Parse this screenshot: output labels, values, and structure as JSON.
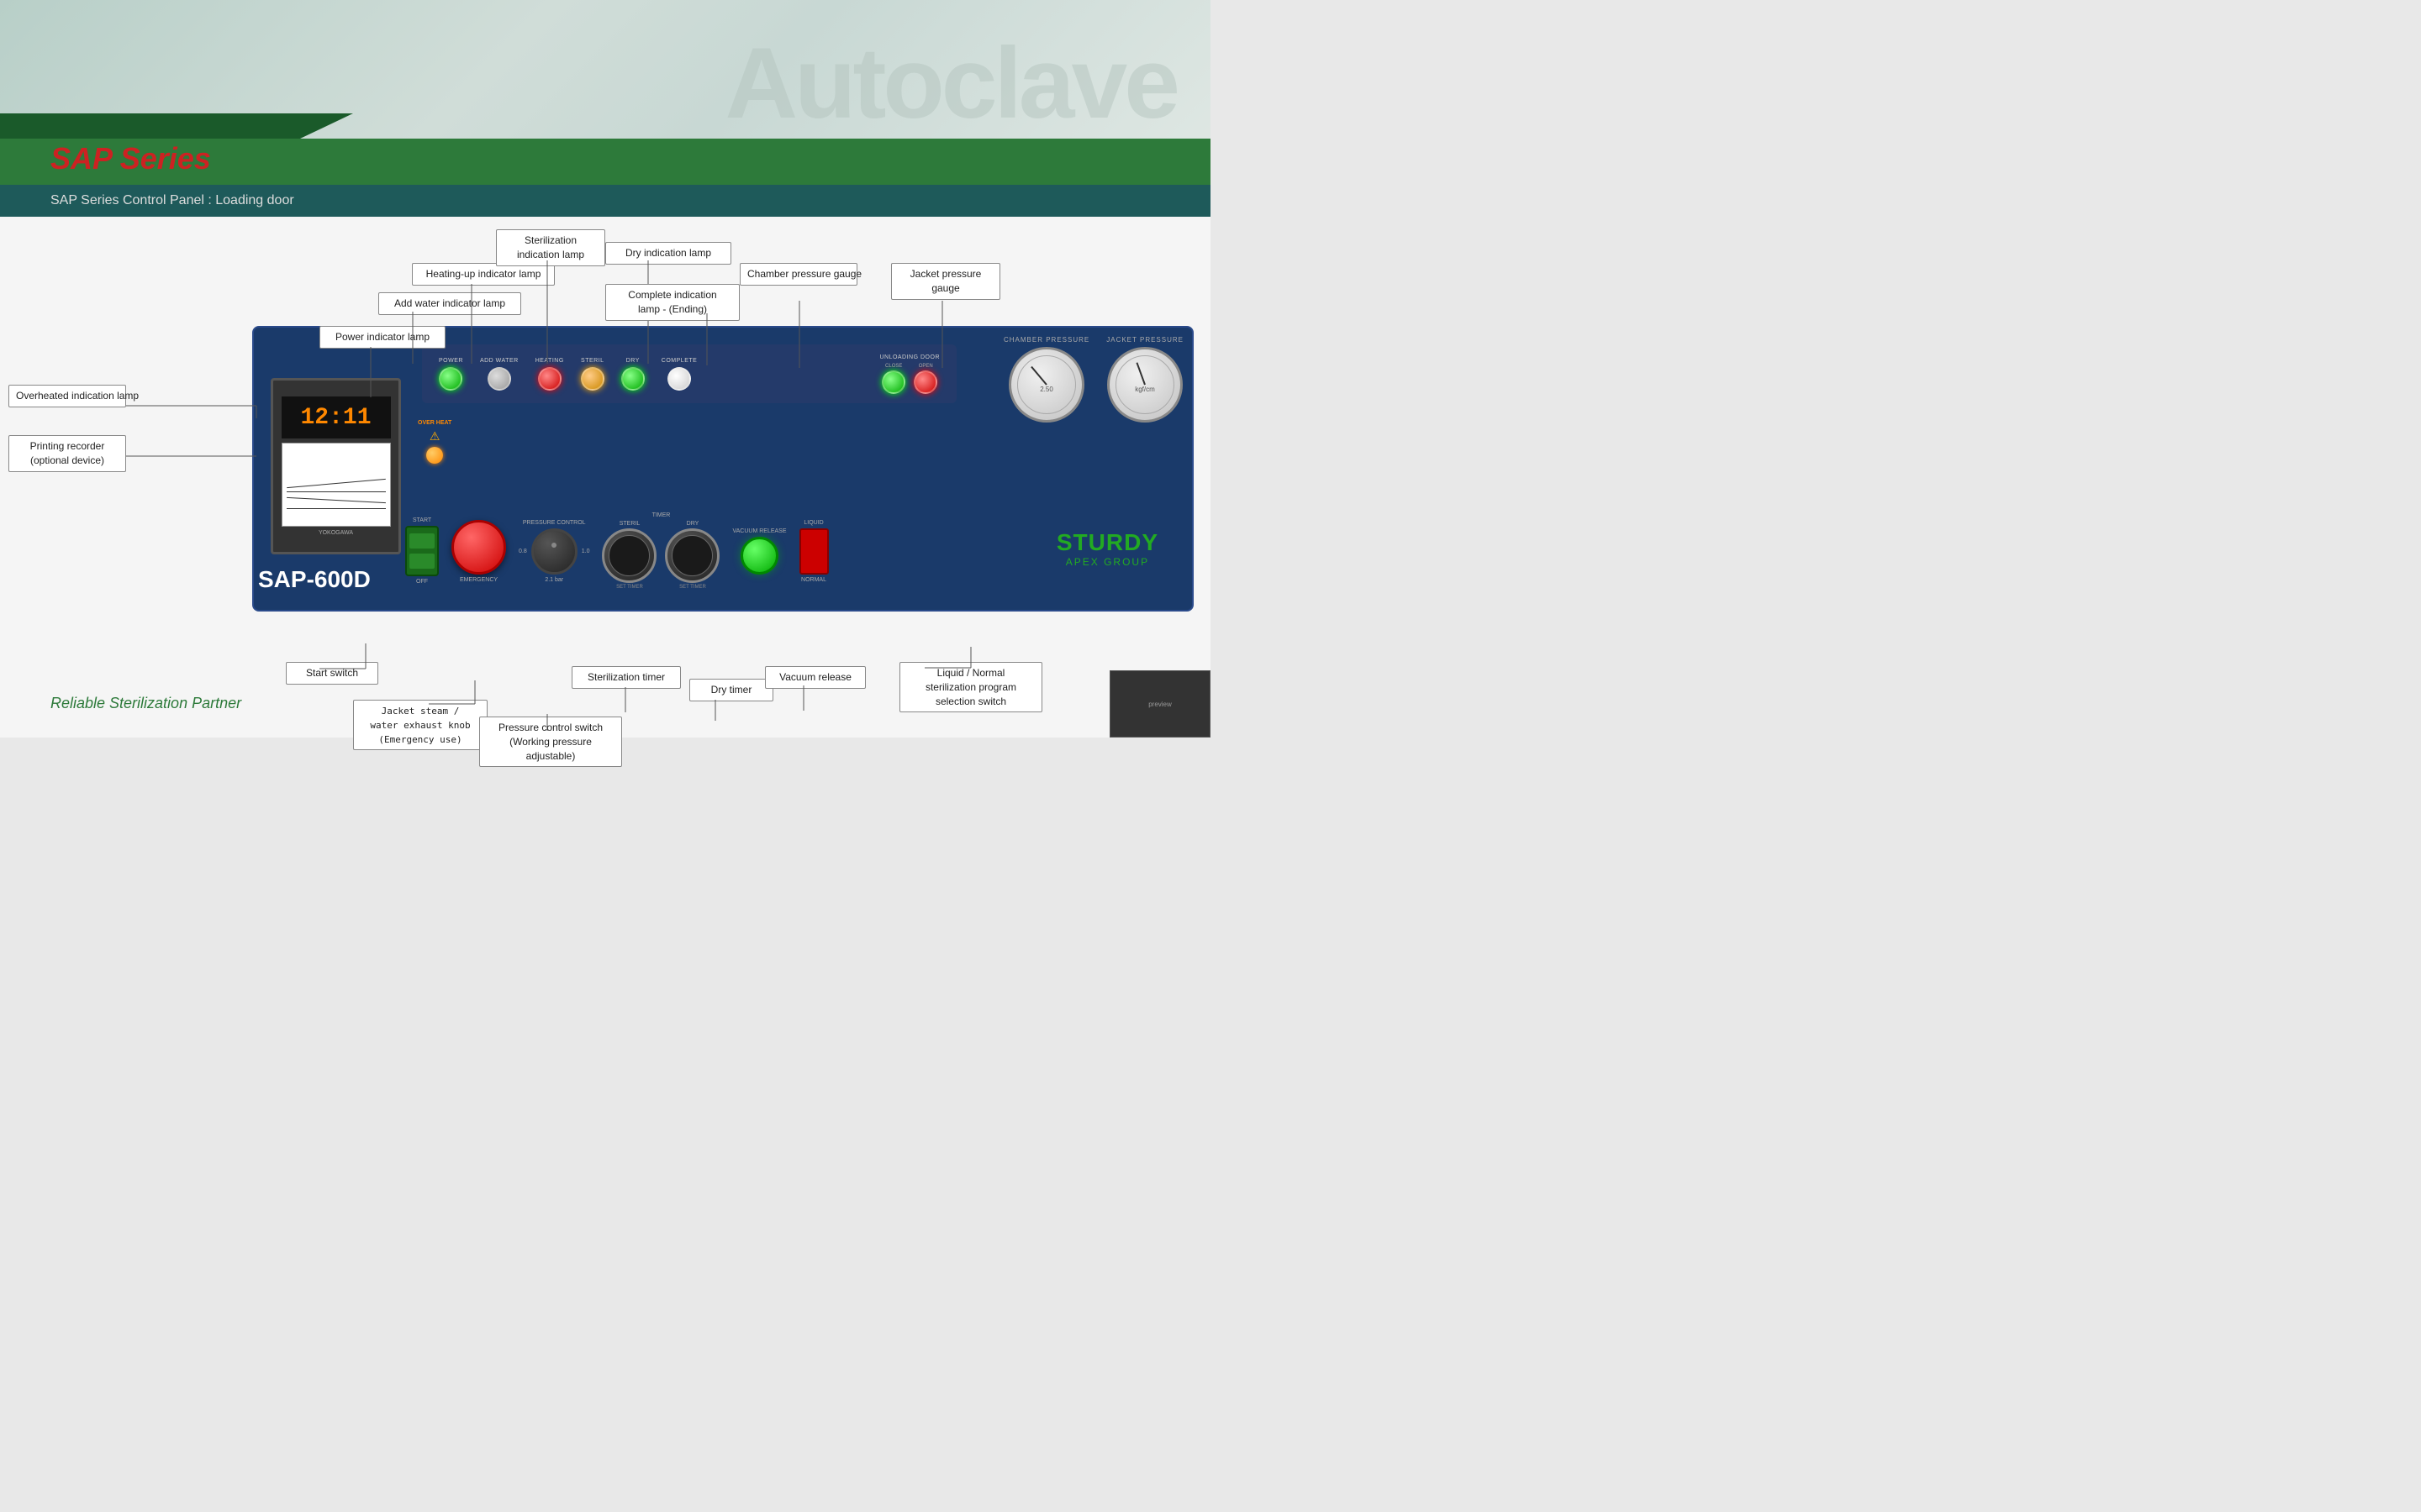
{
  "header": {
    "autoclave_text": "Autoclave",
    "series_label": "SAP Series",
    "subtitle": "SAP Series Control Panel : Loading door"
  },
  "model": {
    "name": "SAP-600D"
  },
  "annotations": {
    "overheated_lamp": "Overheated indication\nlamp",
    "printing_recorder": "Printing recorder\n(optional device)",
    "power_lamp": "Power indicator lamp",
    "add_water_lamp": "Add water indicator lamp",
    "heating_lamp": "Heating-up indicator lamp",
    "sterilization_lamp": "Sterilization\nindication lamp",
    "dry_lamp": "Dry indication lamp",
    "complete_lamp": "Complete indication\nlamp - (Ending)",
    "chamber_pressure": "Chamber pressure\ngauge",
    "jacket_pressure": "Jacket pressure\ngauge",
    "start_switch": "Start switch",
    "jacket_steam": "Jacket steam /\nwater exhaust knob\n(Emergency use)",
    "pressure_control": "Pressure control switch\n(Working pressure\nadjustable)",
    "sterilization_timer": "Sterilization timer",
    "dry_timer": "Dry timer",
    "vacuum_release": "Vacuum release",
    "liquid_normal": "Liquid / Normal\nsterilization program\nselection switch"
  },
  "lamps": {
    "power": {
      "label": "POWER",
      "color": "green"
    },
    "add_water": {
      "label": "ADD WATER",
      "color": "gray"
    },
    "heating": {
      "label": "HEATING",
      "color": "red"
    },
    "steril": {
      "label": "STERIL",
      "color": "orange"
    },
    "dry": {
      "label": "DRY",
      "color": "green"
    },
    "complete": {
      "label": "COMPLETE",
      "color": "white"
    }
  },
  "unloading_door": {
    "label": "UNLOADING DOOR",
    "close_label": "CLOSE",
    "open_label": "OPEN",
    "close_color": "green",
    "open_color": "red"
  },
  "gauges": {
    "chamber": {
      "label": "CHAMBER PRESSURE"
    },
    "jacket": {
      "label": "JACKET PRESSURE"
    }
  },
  "controls": {
    "start": {
      "label": "START",
      "off_label": "OFF"
    },
    "emergency": {
      "label": "EMERGENCY"
    },
    "pressure_control": {
      "label": "PRESSURE CONTROL",
      "value": "0.8",
      "unit": "2.1 bar"
    },
    "timer": {
      "label": "TIMER"
    },
    "steril_timer": {
      "label": "STERIL"
    },
    "dry_timer": {
      "label": "DRY"
    },
    "vacuum_release": {
      "label": "VACUUM\nRELEASE"
    },
    "liquid": {
      "label": "LIQUID"
    },
    "normal": {
      "label": "NORMAL"
    }
  },
  "overheat": {
    "label": "OVER HEAT"
  },
  "brand": {
    "name": "STURDY",
    "sub": "APEX GROUP"
  },
  "footer": {
    "reliable_text": "Reliable Sterilization Partner"
  }
}
